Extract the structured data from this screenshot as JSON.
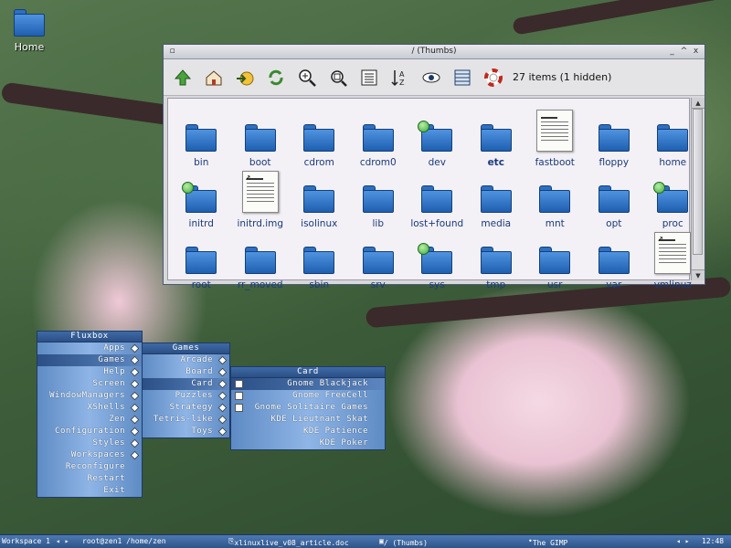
{
  "desktop": {
    "home_label": "Home"
  },
  "window": {
    "title": "/ (Thumbs)",
    "controls": [
      "_",
      "^",
      "x"
    ],
    "status": "27 items (1 hidden)",
    "toolbar": [
      "up-arrow-icon",
      "home-icon",
      "go-icon",
      "refresh-icon",
      "zoom-in-icon",
      "zoom-fit-icon",
      "list-view-icon",
      "sort-icon",
      "show-hidden-icon",
      "details-view-icon",
      "help-icon"
    ],
    "items": [
      {
        "name": "bin",
        "kind": "folder"
      },
      {
        "name": "boot",
        "kind": "folder"
      },
      {
        "name": "cdrom",
        "kind": "folder"
      },
      {
        "name": "cdrom0",
        "kind": "folder"
      },
      {
        "name": "dev",
        "kind": "folder-mount"
      },
      {
        "name": "etc",
        "kind": "folder",
        "bold": true
      },
      {
        "name": "fastboot",
        "kind": "doc"
      },
      {
        "name": "floppy",
        "kind": "folder"
      },
      {
        "name": "home",
        "kind": "folder"
      },
      {
        "name": "initrd",
        "kind": "folder-mount"
      },
      {
        "name": "initrd.img",
        "kind": "doc-link"
      },
      {
        "name": "isolinux",
        "kind": "folder"
      },
      {
        "name": "lib",
        "kind": "folder"
      },
      {
        "name": "lost+found",
        "kind": "folder"
      },
      {
        "name": "media",
        "kind": "folder"
      },
      {
        "name": "mnt",
        "kind": "folder"
      },
      {
        "name": "opt",
        "kind": "folder"
      },
      {
        "name": "proc",
        "kind": "folder-mount"
      },
      {
        "name": "root",
        "kind": "folder"
      },
      {
        "name": "rr_moved",
        "kind": "folder"
      },
      {
        "name": "sbin",
        "kind": "folder"
      },
      {
        "name": "srv",
        "kind": "folder"
      },
      {
        "name": "sys",
        "kind": "folder-mount"
      },
      {
        "name": "tmp",
        "kind": "folder"
      },
      {
        "name": "usr",
        "kind": "folder"
      },
      {
        "name": "var",
        "kind": "folder"
      },
      {
        "name": "vmlinuz",
        "kind": "doc-link"
      }
    ]
  },
  "menus": {
    "root": {
      "title": "Fluxbox",
      "items": [
        "Apps",
        "Games",
        "Help",
        "Screen",
        "WindowManagers",
        "XShells",
        "Zen",
        "Configuration",
        "Styles",
        "Workspaces",
        "Reconfigure",
        "Restart",
        "Exit"
      ],
      "submenu_items": [
        true,
        true,
        true,
        true,
        true,
        true,
        true,
        true,
        true,
        true,
        false,
        false,
        false
      ],
      "selected": 1
    },
    "games": {
      "title": "Games",
      "items": [
        "Arcade",
        "Board",
        "Card",
        "Puzzles",
        "Strategy",
        "Tetris-like",
        "Toys"
      ],
      "selected": 2
    },
    "card": {
      "title": "Card",
      "items": [
        "Gnome Blackjack",
        "Gnome FreeCell",
        "Gnome Solitaire Games",
        "KDE Lieutnant Skat",
        "KDE Patience",
        "KDE Poker"
      ],
      "selected": 0,
      "icons": [
        true,
        true,
        true,
        false,
        false,
        false
      ]
    }
  },
  "taskbar": {
    "workspace": "Workspace 1",
    "prompt": "root@zen1 /home/zen",
    "doc": "xlinuxlive_v08_article.doc",
    "thumbs": "/ (Thumbs)",
    "gimp": "The GIMP",
    "clock": "12:48",
    "arrows_left": "◂ ▸",
    "arrows_right": "◂ ▸"
  },
  "colors": {
    "accent": "#2e5488",
    "folder": "#2f6fc0",
    "menu": "#5e8bc4"
  }
}
